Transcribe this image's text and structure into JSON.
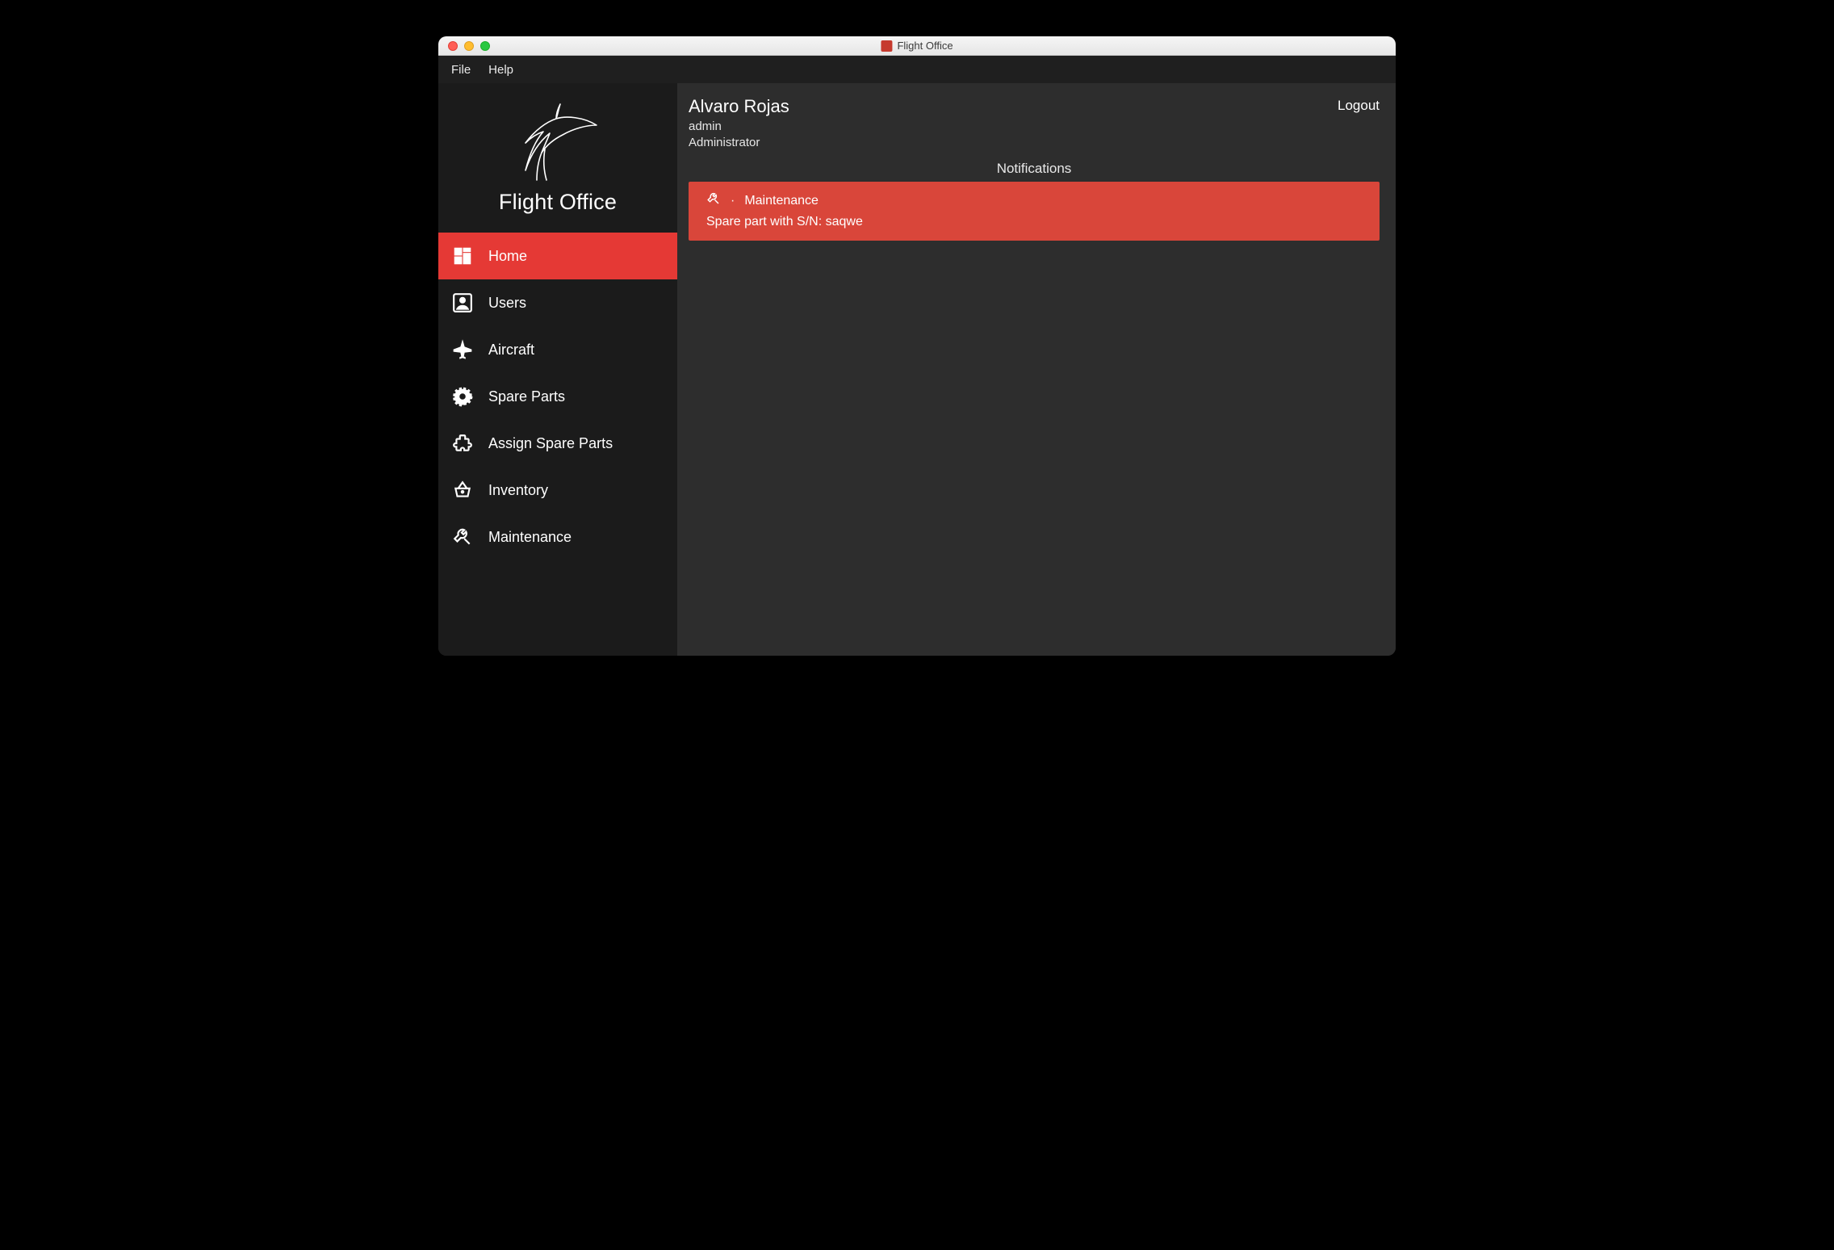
{
  "window": {
    "title": "Flight Office"
  },
  "menubar": {
    "file": "File",
    "help": "Help"
  },
  "sidebar": {
    "app_name": "Flight Office",
    "items": [
      {
        "label": "Home"
      },
      {
        "label": "Users"
      },
      {
        "label": "Aircraft"
      },
      {
        "label": "Spare Parts"
      },
      {
        "label": "Assign Spare Parts"
      },
      {
        "label": "Inventory"
      },
      {
        "label": "Maintenance"
      }
    ]
  },
  "content": {
    "user_name": "Alvaro Rojas",
    "user_login": "admin",
    "user_role": "Administrator",
    "logout": "Logout",
    "notifications_title": "Notifications",
    "notification": {
      "category": "Maintenance",
      "message": "Spare part with S/N: saqwe"
    }
  },
  "colors": {
    "accent": "#e53935",
    "notif": "#d9463a",
    "bg_dark": "#1b1b1b",
    "bg_main": "#2d2d2d"
  }
}
